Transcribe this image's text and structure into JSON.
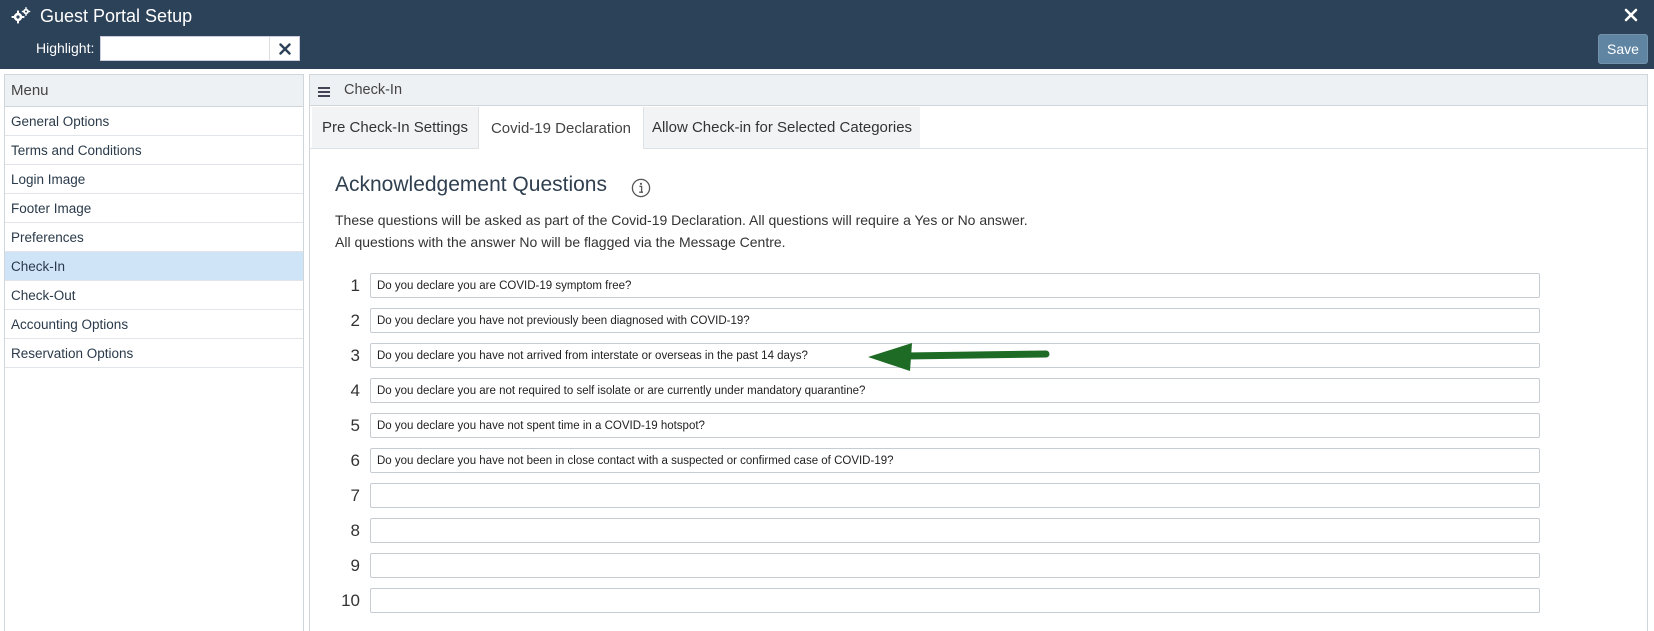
{
  "window": {
    "title": "Guest Portal Setup",
    "title_icon": "gears-icon",
    "close_icon": "close-icon"
  },
  "toolbar": {
    "highlight_label": "Highlight:",
    "highlight_value": "",
    "save_label": "Save"
  },
  "sidebar": {
    "heading": "Menu",
    "items": [
      {
        "label": "General Options",
        "active": false
      },
      {
        "label": "Terms and Conditions",
        "active": false
      },
      {
        "label": "Login Image",
        "active": false
      },
      {
        "label": "Footer Image",
        "active": false
      },
      {
        "label": "Preferences",
        "active": false
      },
      {
        "label": "Check-In",
        "active": true
      },
      {
        "label": "Check-Out",
        "active": false
      },
      {
        "label": "Accounting Options",
        "active": false
      },
      {
        "label": "Reservation Options",
        "active": false
      }
    ]
  },
  "main": {
    "heading": "Check-In",
    "tabs": [
      {
        "label": "Pre Check-In Settings",
        "active": false
      },
      {
        "label": "Covid-19 Declaration",
        "active": true
      },
      {
        "label": "Allow Check-in for Selected Categories",
        "active": false
      }
    ],
    "section_title": "Acknowledgement Questions",
    "description_line1": "These questions will be asked as part of the Covid-19 Declaration. All questions will require a Yes or No answer.",
    "description_line2": "All questions with the answer No will be flagged via the Message Centre.",
    "questions": [
      {
        "num": "1",
        "value": "Do you declare you are COVID-19 symptom free?"
      },
      {
        "num": "2",
        "value": "Do you declare you have not previously been diagnosed with COVID-19?"
      },
      {
        "num": "3",
        "value": "Do you declare you have not arrived from interstate or overseas in the past 14 days?"
      },
      {
        "num": "4",
        "value": "Do you declare you are not required to self isolate or are currently under mandatory quarantine?"
      },
      {
        "num": "5",
        "value": "Do you declare you have not spent time in a COVID-19 hotspot?"
      },
      {
        "num": "6",
        "value": "Do you declare you have not been in close contact with a suspected or confirmed case of COVID-19?"
      },
      {
        "num": "7",
        "value": ""
      },
      {
        "num": "8",
        "value": ""
      },
      {
        "num": "9",
        "value": ""
      },
      {
        "num": "10",
        "value": ""
      }
    ]
  },
  "colors": {
    "header_bg": "#2c4258",
    "save_bg": "#5f85a3",
    "active_menu_bg": "#cfe5f7",
    "arrow": "#1d6b24"
  }
}
